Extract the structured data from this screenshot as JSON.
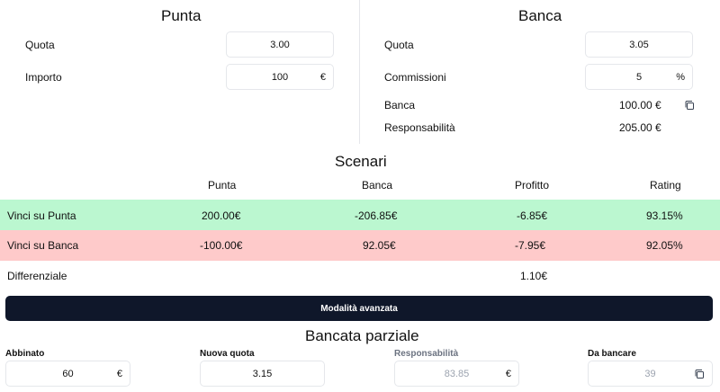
{
  "punta": {
    "title": "Punta",
    "quota_label": "Quota",
    "quota_value": "3.00",
    "importo_label": "Importo",
    "importo_value": "100",
    "importo_suffix": "€"
  },
  "banca": {
    "title": "Banca",
    "quota_label": "Quota",
    "quota_value": "3.05",
    "commissioni_label": "Commissioni",
    "commissioni_value": "5",
    "commissioni_suffix": "%",
    "banca_label": "Banca",
    "banca_value": "100.00 €",
    "responsabilita_label": "Responsabilità",
    "responsabilita_value": "205.00 €"
  },
  "scenari": {
    "title": "Scenari",
    "headers": [
      "Punta",
      "Banca",
      "Profitto",
      "Rating"
    ],
    "rows": [
      {
        "label": "Vinci su Punta",
        "punta": "200.00€",
        "banca": "-206.85€",
        "profitto": "-6.85€",
        "rating": "93.15%"
      },
      {
        "label": "Vinci su Banca",
        "punta": "-100.00€",
        "banca": "92.05€",
        "profitto": "-7.95€",
        "rating": "92.05%"
      },
      {
        "label": "Differenziale",
        "punta": "",
        "banca": "",
        "profitto": "1.10€",
        "rating": ""
      }
    ],
    "row_colors": {
      "win_punta": "#bbf7d0",
      "win_banca": "#fecaca"
    }
  },
  "advanced_button_label": "Modalità avanzata",
  "parziale": {
    "title": "Bancata parziale",
    "abbinato_label": "Abbinato",
    "abbinato_value": "60",
    "abbinato_suffix": "€",
    "nuova_quota_label": "Nuova quota",
    "nuova_quota_value": "3.15",
    "responsabilita_label": "Responsabilità",
    "responsabilita_value": "83.85",
    "responsabilita_suffix": "€",
    "da_bancare_label": "Da bancare",
    "da_bancare_value": "39"
  },
  "icons": {
    "copy": "copy-icon"
  },
  "colors": {
    "accent_dark": "#0f172a",
    "border": "#e5e7eb"
  }
}
